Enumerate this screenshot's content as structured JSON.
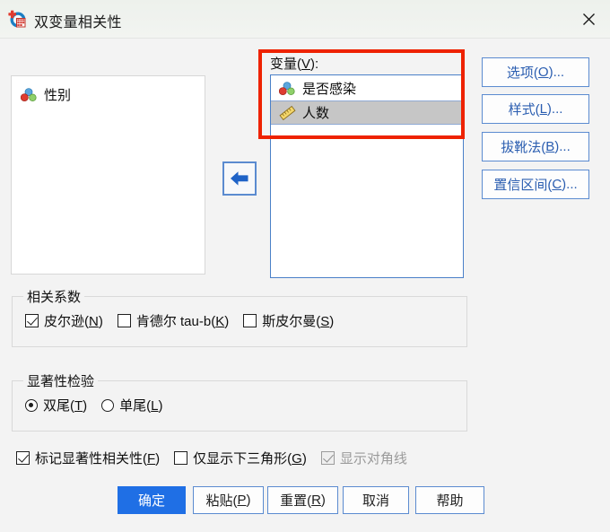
{
  "window": {
    "title": "双变量相关性",
    "icon": "spss-correlation-icon",
    "close_label": "✕"
  },
  "source_list": {
    "items": [
      {
        "label": "性别",
        "icon": "nominal-variable-icon",
        "selected": false
      }
    ]
  },
  "target_list": {
    "caption": "变量(V):",
    "caption_main": "变量(",
    "caption_key": "V",
    "caption_tail": "):",
    "items": [
      {
        "label": "是否感染",
        "icon": "nominal-variable-icon",
        "selected": false
      },
      {
        "label": "人数",
        "icon": "scale-variable-icon",
        "selected": true
      }
    ]
  },
  "move_button": {
    "label": "move-left-arrow",
    "icon": "arrow-left-icon"
  },
  "side_buttons": [
    {
      "main": "选项(",
      "key": "O",
      "tail": ")..."
    },
    {
      "main": "样式(",
      "key": "L",
      "tail": ")..."
    },
    {
      "main": "拔靴法(",
      "key": "B",
      "tail": ")..."
    },
    {
      "main": "置信区间(",
      "key": "C",
      "tail": ")..."
    }
  ],
  "coefficients_group": {
    "title": "相关系数",
    "options": [
      {
        "main": "皮尔逊(",
        "key": "N",
        "tail": ")",
        "checked": true
      },
      {
        "main": "肯德尔 tau-b(",
        "key": "K",
        "tail": ")",
        "checked": false
      },
      {
        "main": "斯皮尔曼(",
        "key": "S",
        "tail": ")",
        "checked": false
      }
    ]
  },
  "significance_group": {
    "title": "显著性检验",
    "options": [
      {
        "main": "双尾(",
        "key": "T",
        "tail": ")",
        "checked": true
      },
      {
        "main": "单尾(",
        "key": "L",
        "tail": ")",
        "checked": false
      }
    ]
  },
  "bottom_options": [
    {
      "main": "标记显著性相关性(",
      "key": "F",
      "tail": ")",
      "checked": true,
      "disabled": false
    },
    {
      "main": "仅显示下三角形(",
      "key": "G",
      "tail": ")",
      "checked": false,
      "disabled": false
    },
    {
      "main": "显示对角线",
      "key": "",
      "tail": "",
      "checked": true,
      "disabled": true
    }
  ],
  "action_buttons": [
    {
      "main": "确定",
      "key": "",
      "tail": "",
      "primary": true
    },
    {
      "main": "粘贴(",
      "key": "P",
      "tail": ")",
      "primary": false
    },
    {
      "main": "重置(",
      "key": "R",
      "tail": ")",
      "primary": false
    },
    {
      "main": "取消",
      "key": "",
      "tail": "",
      "primary": false
    },
    {
      "main": "帮助",
      "key": "",
      "tail": "",
      "primary": false
    }
  ],
  "annotation": {
    "highlight_color": "#ee2200",
    "target": "variables-list-highlight"
  },
  "colors": {
    "dialog_background": "#f3f3f3",
    "titlebar": "#eef2ee",
    "accent_blue": "#1f6fe5",
    "button_border_blue": "#5b8bd0",
    "selection_gray": "#c6c6c6"
  }
}
